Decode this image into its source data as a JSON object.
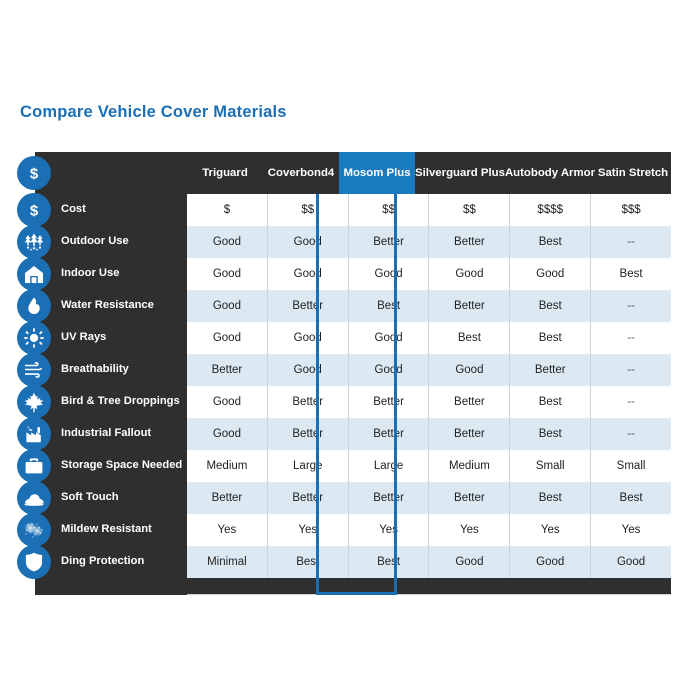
{
  "page": {
    "title": "Compare Vehicle Cover Materials",
    "title_color": "#1a6fb5",
    "background": "#ffffff",
    "panel_color": "#2f2f2f",
    "accent_color": "#1a6fb5",
    "highlight_header_color": "#1a7ac0",
    "alt_row_color": "#dce9f2"
  },
  "table": {
    "corner_icon": "dollar-icon",
    "columns": [
      {
        "label": "Triguard",
        "highlighted": false
      },
      {
        "label": "Coverbond4",
        "highlighted": false
      },
      {
        "label": "Mosom Plus",
        "highlighted": true
      },
      {
        "label": "Silverguard Plus",
        "highlighted": false
      },
      {
        "label": "Autobody Armor",
        "highlighted": false
      },
      {
        "label": "Satin Stretch",
        "highlighted": false
      }
    ],
    "rows": [
      {
        "label": "Cost",
        "icon": "dollar-icon",
        "values": [
          "$",
          "$$",
          "$$",
          "$$",
          "$$$$",
          "$$$"
        ]
      },
      {
        "label": "Outdoor Use",
        "icon": "trees-icon",
        "values": [
          "Good",
          "Good",
          "Better",
          "Better",
          "Best",
          "--"
        ]
      },
      {
        "label": "Indoor Use",
        "icon": "garage-home-icon",
        "values": [
          "Good",
          "Good",
          "Good",
          "Good",
          "Good",
          "Best"
        ]
      },
      {
        "label": "Water Resistance",
        "icon": "water-drop-icon",
        "values": [
          "Good",
          "Better",
          "Best",
          "Better",
          "Best",
          "--"
        ]
      },
      {
        "label": "UV Rays",
        "icon": "sun-icon",
        "values": [
          "Good",
          "Good",
          "Good",
          "Best",
          "Best",
          "--"
        ]
      },
      {
        "label": "Breathability",
        "icon": "wind-icon",
        "values": [
          "Better",
          "Good",
          "Good",
          "Good",
          "Better",
          "--"
        ]
      },
      {
        "label": "Bird & Tree Droppings",
        "icon": "leaf-icon",
        "values": [
          "Good",
          "Better",
          "Better",
          "Better",
          "Best",
          "--"
        ]
      },
      {
        "label": "Industrial Fallout",
        "icon": "factory-icon",
        "values": [
          "Good",
          "Better",
          "Better",
          "Better",
          "Best",
          "--"
        ]
      },
      {
        "label": "Storage Space Needed",
        "icon": "storage-bag-icon",
        "values": [
          "Medium",
          "Large",
          "Large",
          "Medium",
          "Small",
          "Small"
        ]
      },
      {
        "label": "Soft Touch",
        "icon": "soft-fabric-icon",
        "values": [
          "Better",
          "Better",
          "Better",
          "Better",
          "Best",
          "Best"
        ]
      },
      {
        "label": "Mildew Resistant",
        "icon": "mildew-texture-icon",
        "values": [
          "Yes",
          "Yes",
          "Yes",
          "Yes",
          "Yes",
          "Yes"
        ]
      },
      {
        "label": "Ding Protection",
        "icon": "shield-icon",
        "values": [
          "Minimal",
          "Best",
          "Best",
          "Good",
          "Good",
          "Good"
        ]
      }
    ]
  }
}
